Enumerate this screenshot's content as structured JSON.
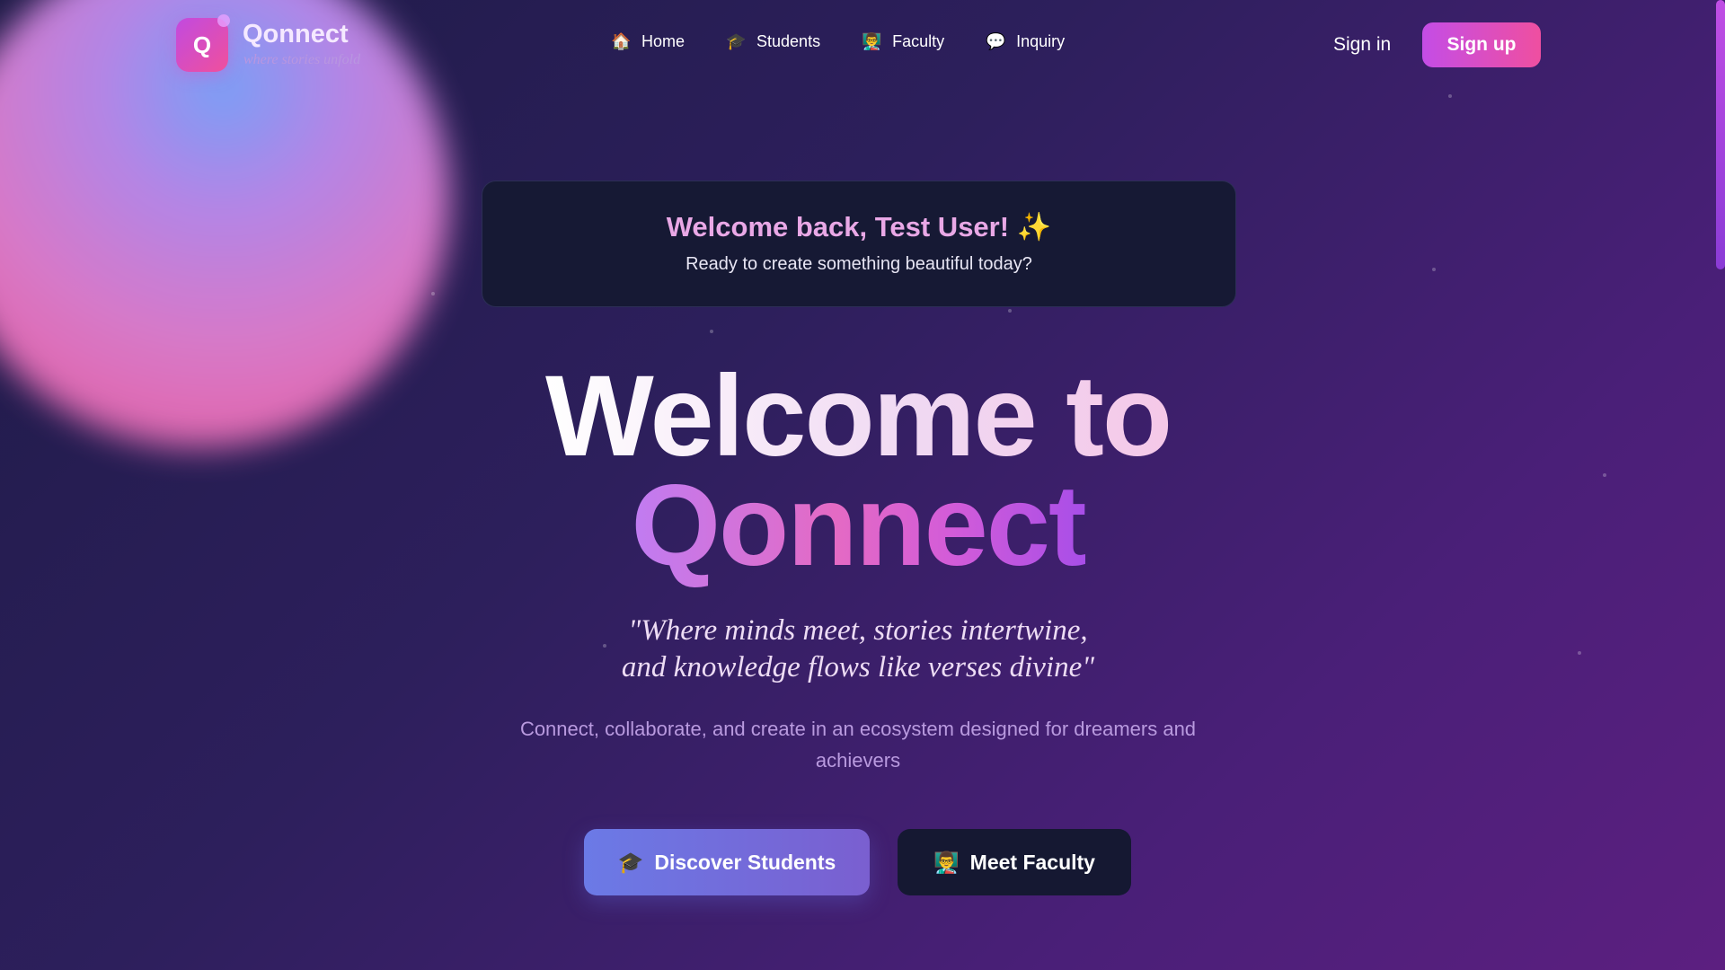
{
  "brand": {
    "logo_letter": "Q",
    "name": "Qonnect",
    "tagline": "where stories unfold"
  },
  "nav": {
    "items": [
      {
        "icon": "🏠",
        "label": "Home"
      },
      {
        "icon": "🎓",
        "label": "Students"
      },
      {
        "icon": "👨‍🏫",
        "label": "Faculty"
      },
      {
        "icon": "💬",
        "label": "Inquiry"
      }
    ],
    "signin": "Sign in",
    "signup": "Sign up"
  },
  "welcome_card": {
    "title": "Welcome back, Test User! ✨",
    "subtitle": "Ready to create something beautiful today?"
  },
  "hero": {
    "line1": "Welcome to",
    "line2": "Qonnect",
    "quote_line1": "\"Where minds meet, stories intertwine,",
    "quote_line2": "and knowledge flows like verses divine\"",
    "description": "Connect, collaborate, and create in an ecosystem designed for dreamers and achievers"
  },
  "cta": {
    "discover_icon": "🎓",
    "discover_label": "Discover Students",
    "faculty_icon": "👨‍🏫",
    "faculty_label": "Meet Faculty"
  },
  "colors": {
    "accent_pink": "#ef4fa0",
    "accent_purple": "#c44de6",
    "background": "#2d1f5c",
    "card": "#161934"
  }
}
